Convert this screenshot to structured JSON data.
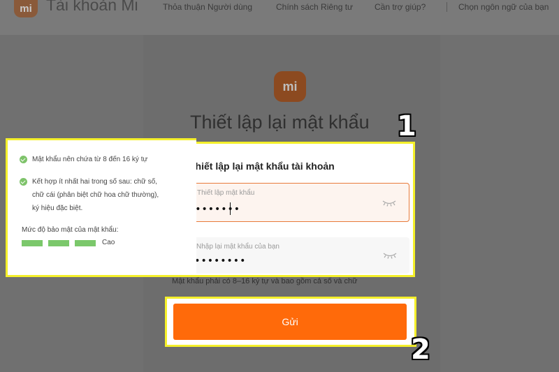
{
  "header": {
    "logo_text": "mi",
    "brand": "Tài khoản Mi",
    "links": [
      "Thỏa thuận Người dùng",
      "Chính sách Riêng tư",
      "Cần trợ giúp?",
      "Chọn ngôn ngữ của bạn"
    ]
  },
  "main": {
    "logo_text": "mi",
    "title": "Thiết lập lại mật khẩu"
  },
  "form": {
    "title": "Thiết lập lại mật khẩu tài khoản",
    "field1": {
      "label": "Thiết lập mật khẩu",
      "value": "••••••••"
    },
    "field2": {
      "label": "Nhập lại mật khẩu của bạn",
      "value": "•••••••••"
    },
    "helper": "Mật khẩu phải có 8–16 ký tự và bao gồm cả số và chữ",
    "submit_label": "Gửi"
  },
  "popup": {
    "requirements": [
      "Mật khẩu nên chứa từ 8 đến 16 ký tự",
      "Kết hợp ít nhất hai trong số sau: chữ số,",
      "chữ cái (phân biệt chữ hoa chữ thường),",
      "ký hiệu đặc biệt."
    ],
    "strength_label": "Mức độ bảo mật của mật khẩu:",
    "strength_value": "Cao",
    "strength_level": 3
  },
  "annotations": {
    "step1": "1",
    "step2": "2"
  },
  "colors": {
    "accent": "#ff6a0a",
    "highlight": "#f4ef2a",
    "check": "#7ec36a"
  },
  "icons": [
    "eye-closed-icon",
    "check-circle-icon"
  ]
}
